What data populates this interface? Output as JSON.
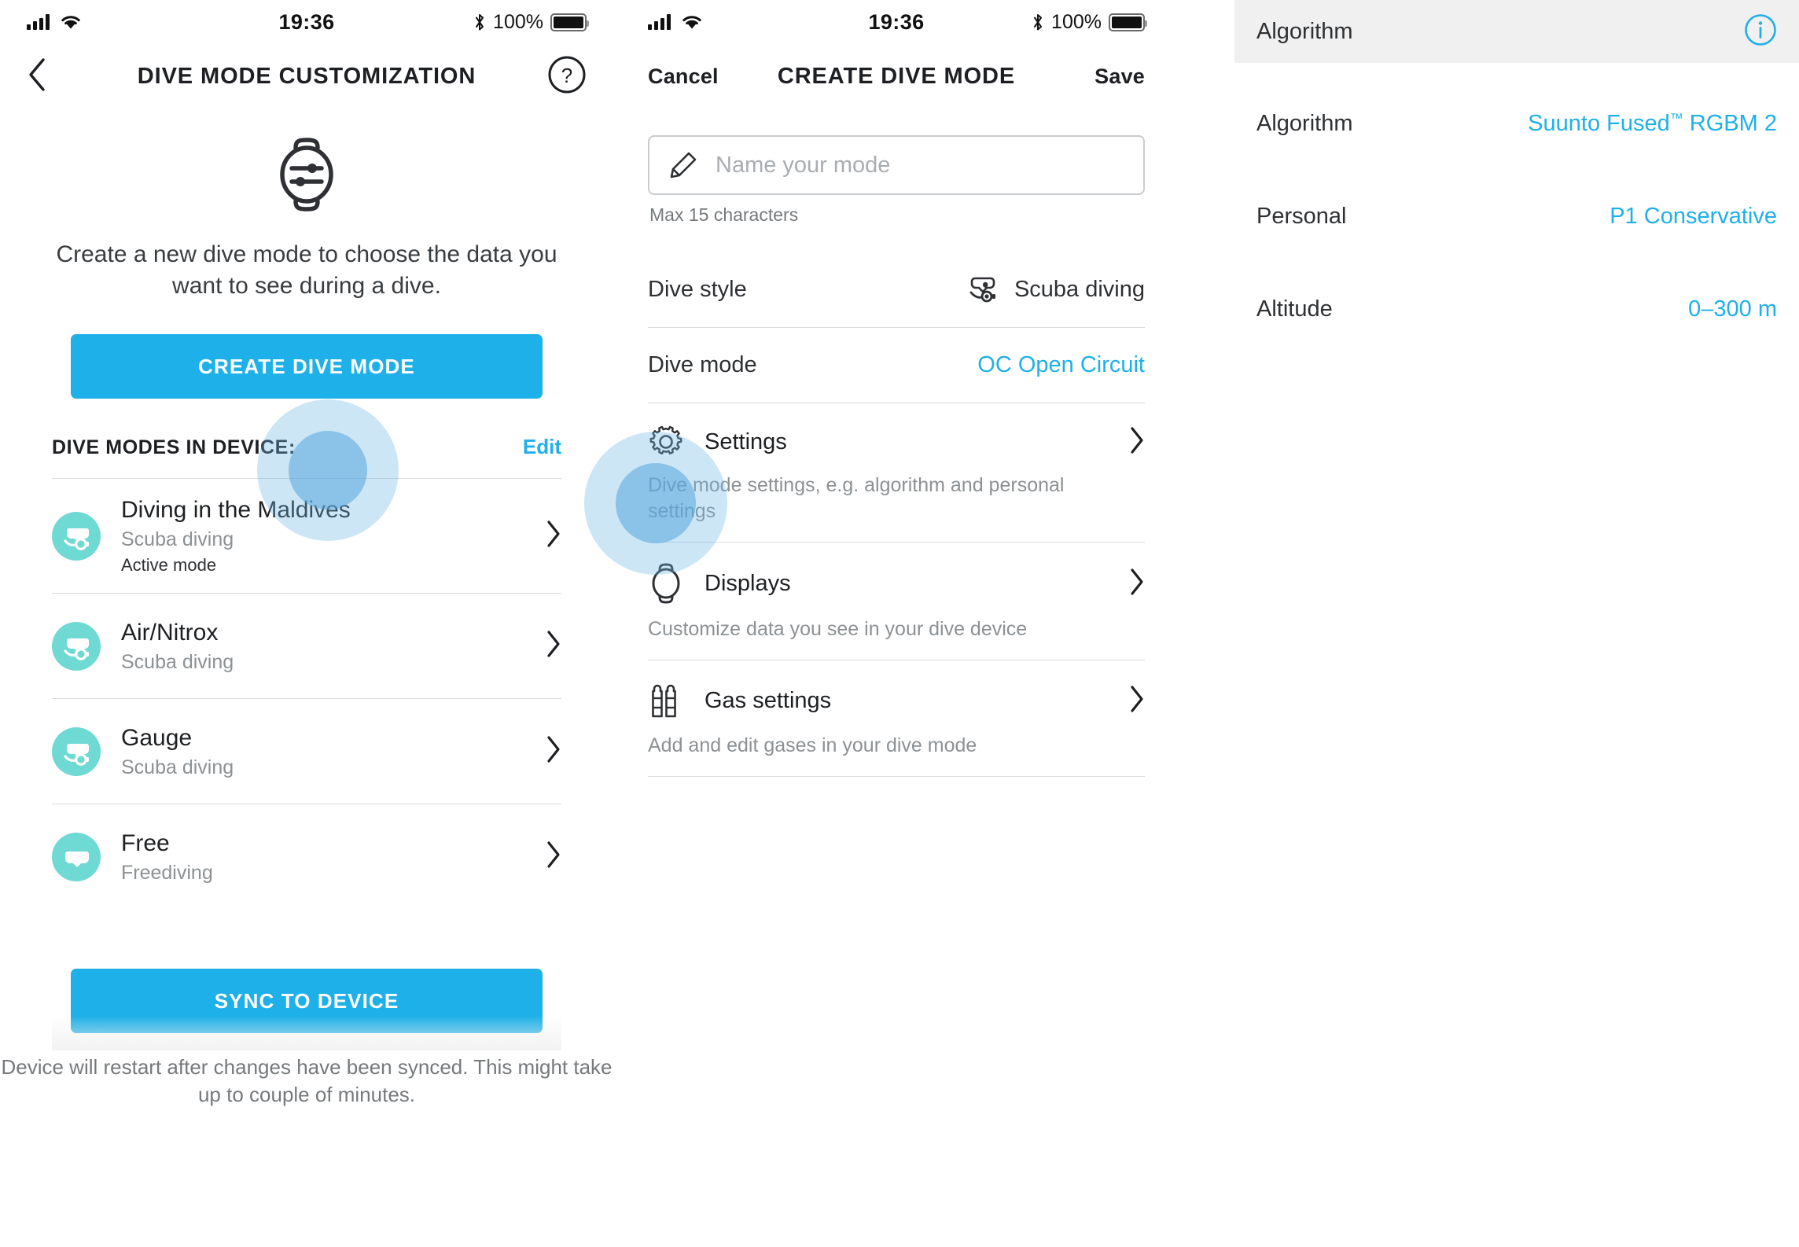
{
  "status_bar": {
    "time": "19:36",
    "battery_percent": "100%",
    "signal_icon": "signal-bars-icon",
    "wifi_icon": "wifi-icon",
    "bluetooth_icon": "bluetooth-icon",
    "battery_icon": "battery-icon"
  },
  "colors": {
    "accent": "#1eb0e8",
    "mode_icon_bg": "#6fd9d3",
    "header_bg": "#f0f0f0",
    "muted_text": "#8d9194"
  },
  "panel_device_modes": {
    "nav": {
      "back_icon": "chevron-left-icon",
      "title": "DIVE MODE CUSTOMIZATION",
      "help_icon": "question-mark-circle-icon"
    },
    "hero_icon": "watch-settings-icon",
    "intro_text": "Create a new dive mode to choose the data you want to see during a dive.",
    "create_button_label": "CREATE DIVE MODE",
    "section_title": "DIVE MODES IN DEVICE:",
    "edit_label": "Edit",
    "modes": [
      {
        "name": "Diving in the Maldives",
        "style": "Scuba diving",
        "status": "Active mode",
        "icon": "scuba-mask-regulator-icon"
      },
      {
        "name": "Air/Nitrox",
        "style": "Scuba diving",
        "status": "",
        "icon": "scuba-mask-regulator-icon"
      },
      {
        "name": "Gauge",
        "style": "Scuba diving",
        "status": "",
        "icon": "scuba-mask-regulator-icon"
      },
      {
        "name": "Free",
        "style": "Freediving",
        "status": "",
        "icon": "freediving-mask-icon"
      }
    ],
    "sync_button_label": "SYNC TO DEVICE",
    "footnote": "Device will restart after changes have been synced. This might take up to couple of minutes."
  },
  "panel_create_mode": {
    "nav": {
      "cancel_label": "Cancel",
      "title": "CREATE DIVE MODE",
      "save_label": "Save"
    },
    "name_field": {
      "icon": "pencil-edit-icon",
      "value": "",
      "placeholder": "Name your mode",
      "hint": "Max 15 characters"
    },
    "dive_style": {
      "label": "Dive style",
      "value": "Scuba diving",
      "icon": "scuba-mask-regulator-icon"
    },
    "dive_mode": {
      "label": "Dive mode",
      "value": "OC Open Circuit"
    },
    "nav_items": [
      {
        "label": "Settings",
        "desc": "Dive mode settings, e.g. algorithm and personal settings",
        "icon": "gear-icon"
      },
      {
        "label": "Displays",
        "desc": "Customize data you see in your dive device",
        "icon": "watch-icon"
      },
      {
        "label": "Gas settings",
        "desc": "Add and edit gases in your dive mode",
        "icon": "gas-tanks-icon"
      }
    ]
  },
  "panel_algorithm": {
    "header": {
      "title": "Algorithm",
      "info_icon": "info-circle-icon"
    },
    "rows": [
      {
        "label": "Algorithm",
        "value_prefix": "Suunto Fused",
        "value_tm": "™",
        "value_suffix": " RGBM 2"
      },
      {
        "label": "Personal",
        "value": "P1 Conservative"
      },
      {
        "label": "Altitude",
        "value": "0–300 m"
      }
    ]
  }
}
